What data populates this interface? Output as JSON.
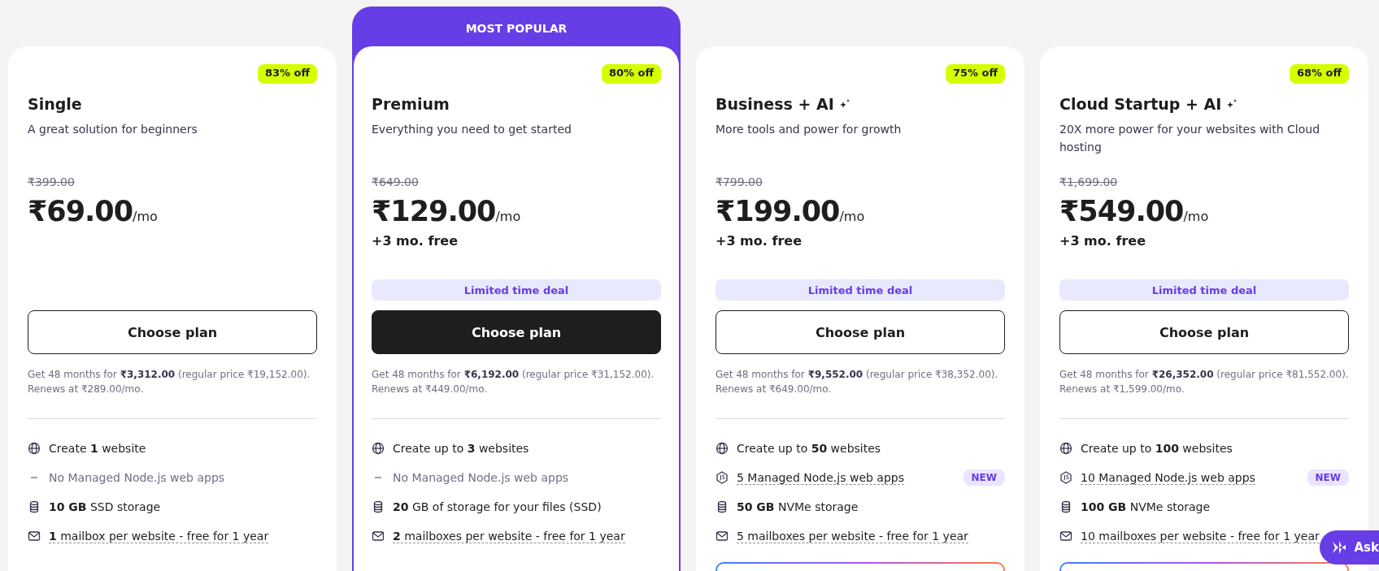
{
  "plans": [
    {
      "name": "Single",
      "ai": false,
      "popular": false,
      "discount": "83% off",
      "description": "A great solution for beginners",
      "old_price": "₹399.00",
      "price": "₹69.00",
      "period": "/mo",
      "button": "Choose plan",
      "terms": "Get 48 months for **₹3,312.00** (regular price ₹19,152.00). Renews at ₹289.00/mo.",
      "features": [
        {
          "kind": "globe",
          "text": "Create **1** website",
          "disabled": false,
          "dashed": false
        },
        {
          "kind": "dash",
          "text": "No Managed Node.js web apps",
          "disabled": true,
          "dashed": false
        },
        {
          "kind": "storage",
          "text": "**10 GB** SSD storage",
          "disabled": false,
          "dashed": false
        },
        {
          "kind": "mail",
          "text": "**1** mailbox per website - free for 1 year",
          "disabled": false,
          "dashed": true
        }
      ],
      "extra": false
    },
    {
      "name": "Premium",
      "ai": false,
      "popular": true,
      "ribbon": "MOST POPULAR",
      "discount": "80% off",
      "description": "Everything you need to get started",
      "old_price": "₹649.00",
      "price": "₹129.00",
      "period": "/mo",
      "bonus": "+3 mo. free",
      "deal": "Limited time deal",
      "button": "Choose plan",
      "terms": "Get 48 months for **₹6,192.00** (regular price ₹31,152.00). Renews at ₹449.00/mo.",
      "features": [
        {
          "kind": "globe",
          "text": "Create up to **3** websites",
          "disabled": false,
          "dashed": false
        },
        {
          "kind": "dash",
          "text": "No Managed Node.js web apps",
          "disabled": true,
          "dashed": false
        },
        {
          "kind": "storage",
          "text": "**20** GB of storage for your files (SSD)",
          "disabled": false,
          "dashed": false
        },
        {
          "kind": "mail",
          "text": "**2** mailboxes per website - free for 1 year",
          "disabled": false,
          "dashed": true
        }
      ],
      "extra": false
    },
    {
      "name": "Business + AI",
      "ai": true,
      "popular": false,
      "discount": "75% off",
      "description": "More tools and power for growth",
      "old_price": "₹799.00",
      "price": "₹199.00",
      "period": "/mo",
      "bonus": "+3 mo. free",
      "deal": "Limited time deal",
      "button": "Choose plan",
      "terms": "Get 48 months for **₹9,552.00** (regular price ₹38,352.00). Renews at ₹649.00/mo.",
      "features": [
        {
          "kind": "globe",
          "text": "Create up to **50** websites",
          "disabled": false,
          "dashed": false
        },
        {
          "kind": "node",
          "text": "5 Managed Node.js web apps",
          "disabled": false,
          "dashed": true,
          "tag": "NEW"
        },
        {
          "kind": "storage",
          "text": "**50 GB** NVMe storage",
          "disabled": false,
          "dashed": false
        },
        {
          "kind": "mail",
          "text": "5 mailboxes per website - free for 1 year",
          "disabled": false,
          "dashed": true
        }
      ],
      "extra": true
    },
    {
      "name": "Cloud Startup + AI",
      "ai": true,
      "popular": false,
      "discount": "68% off",
      "description": "20X more power for your websites with Cloud hosting",
      "old_price": "₹1,699.00",
      "price": "₹549.00",
      "period": "/mo",
      "bonus": "+3 mo. free",
      "deal": "Limited time deal",
      "button": "Choose plan",
      "terms": "Get 48 months for **₹26,352.00** (regular price ₹81,552.00). Renews at ₹1,599.00/mo.",
      "features": [
        {
          "kind": "globe",
          "text": "Create up to **100** websites",
          "disabled": false,
          "dashed": false
        },
        {
          "kind": "node",
          "text": "10 Managed Node.js web apps",
          "disabled": false,
          "dashed": true,
          "tag": "NEW"
        },
        {
          "kind": "storage",
          "text": "**100 GB** NVMe storage",
          "disabled": false,
          "dashed": false
        },
        {
          "kind": "mail",
          "text": "10 mailboxes per website - free for 1 year",
          "disabled": false,
          "dashed": true
        }
      ],
      "extra": true
    }
  ],
  "assistant": {
    "label": "Ask"
  }
}
